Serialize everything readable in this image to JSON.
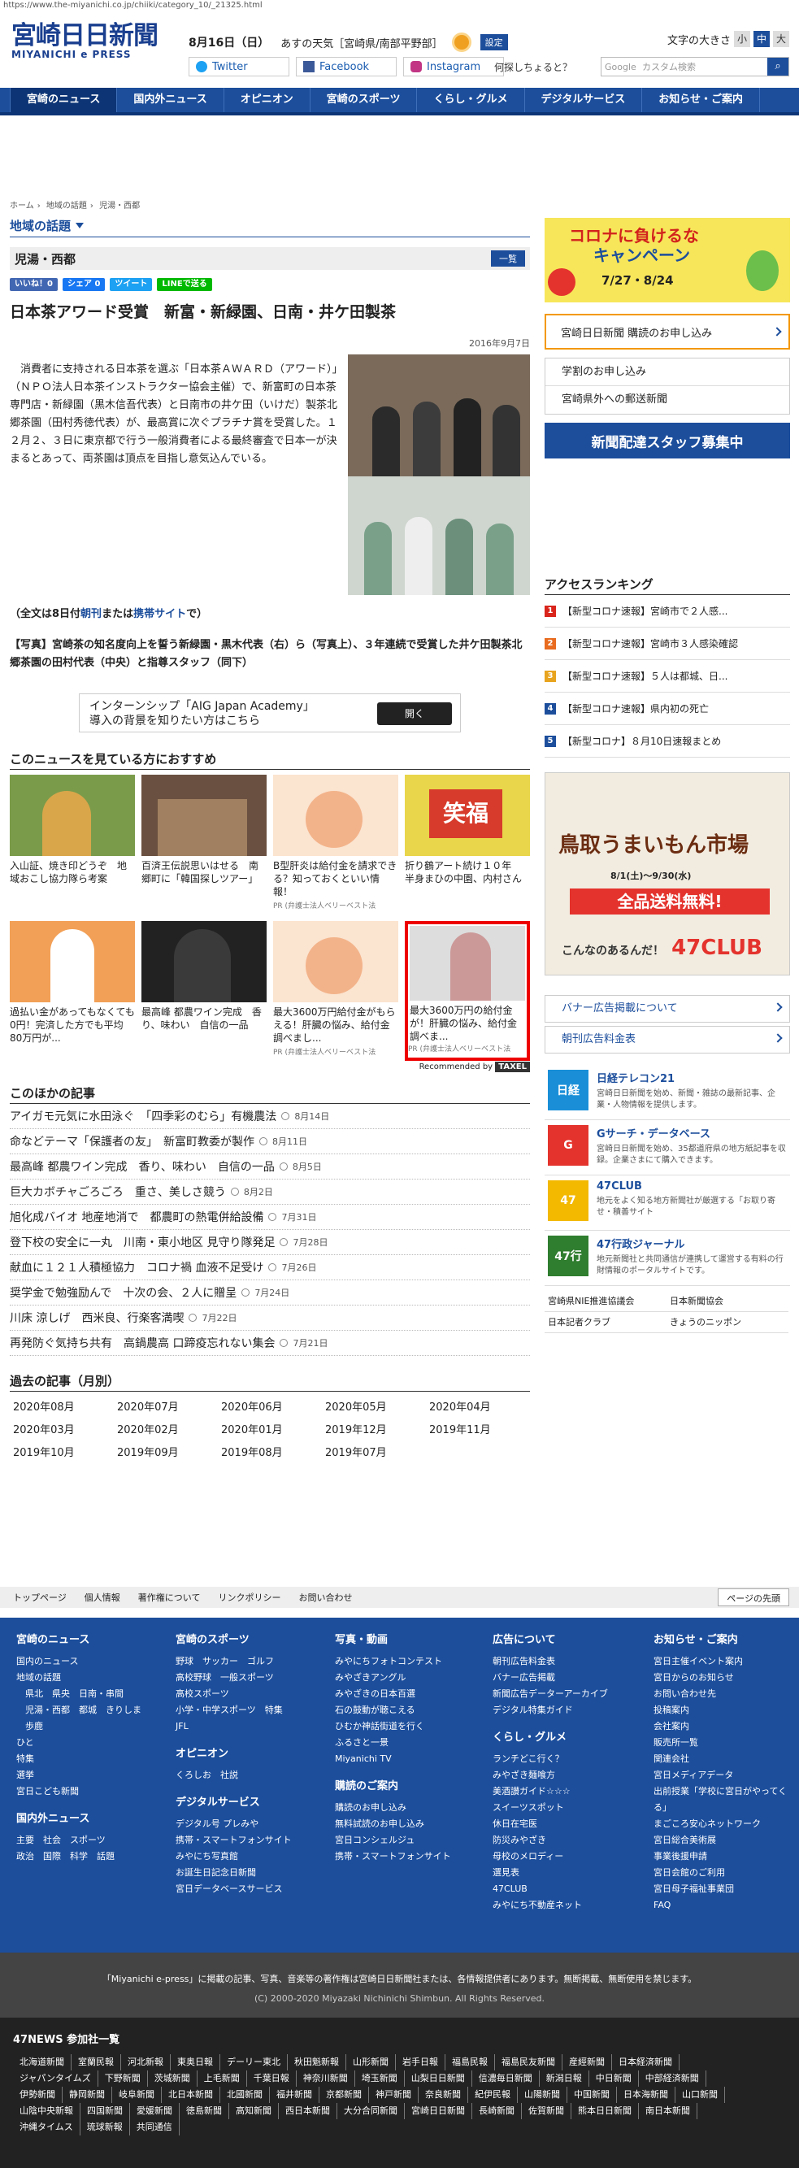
{
  "url": "https://www.the-miyanichi.co.jp/chiiki/category_10/_21325.html",
  "header": {
    "logo_main": "宮崎日日新聞",
    "logo_sub": "MIYANICHI e PRESS",
    "date": "8月16日（日）",
    "weather_label": "あすの天気［宮崎県/南部平野部］",
    "settings_label": "設定",
    "twitter": "Twitter",
    "facebook": "Facebook",
    "instagram": "Instagram",
    "font_size_label": "文字の大きさ",
    "font_small": "小",
    "font_medium": "中",
    "font_large": "大",
    "question_text": "何探しちょると？",
    "search_brand": "Google",
    "search_placeholder": "カスタム検索"
  },
  "nav": [
    "宮崎のニュース",
    "国内外ニュース",
    "オピニオン",
    "宮崎のスポーツ",
    "くらし・グルメ",
    "デジタルサービス",
    "お知らせ・ご案内"
  ],
  "breadcrumb": [
    "ホーム",
    "地域の話題",
    "児湯・西都"
  ],
  "section_title": "地域の話題",
  "subsection": "児湯・西都",
  "list_button": "一覧",
  "share": {
    "like": "いいね！0",
    "share": "シェア 0",
    "tweet": "ツイート",
    "line": "LINEで送る"
  },
  "article": {
    "title": "日本茶アワード受賞　新富・新緑園、日南・井ケ田製茶",
    "date": "2016年9月7日",
    "body": "消費者に支持される日本茶を選ぶ「日本茶ＡＷＡＲＤ（アワード）」（ＮＰＯ法人日本茶インストラクター協会主催）で、新富町の日本茶専門店・新緑園（黒木信吾代表）と日南市の井ケ田（いけだ）製茶北郷茶園（田村秀徳代表）が、最高賞に次ぐプラチナ賞を受賞した。１２月２、３日に東京都で行う一般消費者による最終審査で日本一が決まるとあって、両茶園は頂点を目指し意気込んでいる。",
    "full_prefix": "（全文は8日付",
    "full_link1": "朝刊",
    "full_mid": "または",
    "full_link2": "携帯サイト",
    "full_suffix": "で）",
    "caption": "【写真】宮崎茶の知名度向上を誓う新緑園・黒木代表（右）ら（写真上）、３年連続で受賞した井ケ田製茶北郷茶園の田村代表（中央）と指尊スタッフ（同下）"
  },
  "ad_banner": {
    "line1": "インターンシップ「AIG Japan Academy」",
    "line2": "導入の背景を知りたい方はこちら",
    "button": "開く"
  },
  "recommend": {
    "title": "このニュースを見ている方におすすめ",
    "items": [
      {
        "text": "入山証、焼き印どうぞ　地域おこし協力隊ら考案",
        "pr": ""
      },
      {
        "text": "百済王伝説思いはせる　南郷町に「韓国探しツアー」",
        "pr": ""
      },
      {
        "text": "B型肝炎は給付金を請求できる？知っておくといい情報！",
        "pr": "PR (弁護士法人ベリーベスト法"
      },
      {
        "text": "折り鶴アート続け１０年　半身まひの中園、内村さん",
        "pr": ""
      },
      {
        "text": "過払い金があってもなくても0円！完済した方でも平均80万円が...",
        "pr": ""
      },
      {
        "text": "最高峰 都農ワイン完成　香り、味わい　自信の一品",
        "pr": ""
      },
      {
        "text": "最大3600万円給付金がもらえる！肝臓の悩み、給付金調べまし...",
        "pr": "PR (弁護士法人ベリーベスト法"
      },
      {
        "text": "最大3600万円の給付金が！肝臓の悩み、給付金調べま...",
        "pr": "PR (弁護士法人ベリーベスト法"
      }
    ],
    "by_label": "Recommended by",
    "by_brand": "TAXEL"
  },
  "others": {
    "title": "このほかの記事",
    "items": [
      {
        "t": "アイガモ元気に水田泳ぐ　「四季彩のむら」有機農法",
        "d": "8月14日"
      },
      {
        "t": "命などテーマ「保護者の友」　新富町教委が製作",
        "d": "8月11日"
      },
      {
        "t": "最高峰 都農ワイン完成　香り、味わい　自信の一品",
        "d": "8月5日"
      },
      {
        "t": "巨大カボチャごろごろ　重さ、美しさ競う",
        "d": "8月2日"
      },
      {
        "t": "旭化成バイオ 地産地消で　都農町の熱電併給設備",
        "d": "7月31日"
      },
      {
        "t": "登下校の安全に一丸　川南・東小地区 見守り隊発足",
        "d": "7月28日"
      },
      {
        "t": "献血に１２１人積極協力　コロナ禍 血液不足受け",
        "d": "7月26日"
      },
      {
        "t": "奨学金で勉強励んで　十次の会、２人に贈呈",
        "d": "7月24日"
      },
      {
        "t": "川床 涼しげ　西米良、行楽客満喫",
        "d": "7月22日"
      },
      {
        "t": "再発防ぐ気持ち共有　高鍋農高 口蹄疫忘れない集会",
        "d": "7月21日"
      }
    ]
  },
  "past": {
    "title": "過去の記事（月別）",
    "months": [
      "2020年08月",
      "2020年07月",
      "2020年06月",
      "2020年05月",
      "2020年04月",
      "2020年03月",
      "2020年02月",
      "2020年01月",
      "2019年12月",
      "2019年11月",
      "2019年10月",
      "2019年09月",
      "2019年08月",
      "2019年07月"
    ]
  },
  "side": {
    "corona_title1": "コロナに負けるな",
    "corona_title2": "キャンペーン",
    "corona_dates": "7/27・8/24",
    "subscribe": "宮崎日日新聞 購読のお申し込み",
    "study": "学割のお申し込み",
    "outside": "宮崎県外への郵送新聞",
    "staff": "新聞配達スタッフ募集中",
    "ranking_title": "アクセスランキング",
    "ranking": [
      "【新型コロナ速報】宮崎市で２人感...",
      "【新型コロナ速報】宮崎市３人感染確認",
      "【新型コロナ速報】５人は都城、日...",
      "【新型コロナ速報】県内初の死亡",
      "【新型コロナ】８月10日速報まとめ"
    ],
    "tottori_big": "鳥取うまいもん市場",
    "tottori_period": "8/1(土)〜9/30(水)",
    "tottori_red": "全品送料無料!",
    "tottori_club": "47CLUB",
    "tottori_small": "こんなのあるんだ！",
    "banner_ad": "バナー広告掲載について",
    "ad_rates": "朝刊広告料金表",
    "services": [
      {
        "logo": "日経",
        "name": "日経テレコン21",
        "desc": "宮崎日日新聞を始め、新聞・雑誌の最新記事、企業・人物情報を提供します。"
      },
      {
        "logo": "G",
        "name": "Gサーチ・データベース",
        "desc": "宮崎日日新聞を始め、35都道府県の地方紙記事を収録。企業さまにて購入できます。"
      },
      {
        "logo": "47",
        "name": "47CLUB",
        "desc": "地元をよく知る地方新聞社が厳選する「お取り寄せ・積善サイト"
      },
      {
        "logo": "47行",
        "name": "47行政ジャーナル",
        "desc": "地元新聞社と共同通信が連携して運営する有料の行財情報のポータルサイトです。"
      }
    ],
    "mini_links": [
      "宮崎県NIE推進協議会",
      "日本新聞協会",
      "日本記者クラブ",
      "きょうのニッポン"
    ]
  },
  "footer_nav": [
    "トップページ",
    "個人情報",
    "著作権について",
    "リンクポリシー",
    "お問い合わせ"
  ],
  "page_top": "ページの先頭",
  "footer_cols": [
    {
      "h": "宮崎のニュース",
      "items": [
        "国内のニュース",
        "地域の話題",
        "　県北　県央　日南・串間",
        "　児湯・西都　都城　きりしま",
        "　歩鹿",
        "ひと",
        "特集",
        "選挙",
        "宮日こども新聞"
      ],
      "h2": "国内外ニュース",
      "items2": [
        "主要　社会　スポーツ",
        "政治　国際　科学　話題"
      ]
    },
    {
      "h": "宮崎のスポーツ",
      "items": [
        "野球　サッカー　ゴルフ",
        "高校野球　一般スポーツ",
        "高校スポーツ",
        "小学・中学スポーツ　特集",
        "JFL"
      ],
      "h2": "オピニオン",
      "items2": [
        "くろしお　社説"
      ],
      "h3": "デジタルサービス",
      "items3": [
        "デジタル号 プレみや",
        "携帯・スマートフォンサイト",
        "みやにち写真館",
        "お誕生日記念日新聞",
        "宮日データベースサービス"
      ]
    },
    {
      "h": "写真・動画",
      "items": [
        "みやにちフォトコンテスト",
        "みやざきアングル",
        "みやざきの日本百選",
        "石の鼓動が聴こえる",
        "ひむか神話街道を行く",
        "ふるさと一景",
        "Miyanichi TV"
      ],
      "h2": "購読のご案内",
      "items2": [
        "購読のお申し込み",
        "無料試読のお申し込み",
        "宮日コンシェルジュ",
        "携帯・スマートフォンサイト"
      ]
    },
    {
      "h": "広告について",
      "items": [
        "朝刊広告料金表",
        "バナー広告掲載",
        "新聞広告データーアーカイブ",
        "デジタル特集ガイド"
      ],
      "h2": "くらし・グルメ",
      "items2": [
        "ランチどこ行く？",
        "みやざき麺喰方",
        "美酒讃ガイド☆☆☆",
        "スイーツスポット",
        "休日在宅医",
        "防災みやざき",
        "母校のメロディー",
        "選見表",
        "47CLUB",
        "みやにち不動産ネット"
      ]
    },
    {
      "h": "お知らせ・ご案内",
      "items": [
        "宮日主催イベント案内",
        "宮日からのお知らせ",
        "お問い合わせ先",
        "投稿案内",
        "会社案内",
        "販売所一覧",
        "関連会社",
        "宮日メディアデータ",
        "出前授業「学校に宮日がやってくる」",
        "まごころ安心ネットワーク",
        "宮日総合美術展",
        "事業後援申請",
        "宮日会館のご利用",
        "宮日母子福祉事業団",
        "FAQ"
      ]
    }
  ],
  "copyright1": "「Miyanichi e-press」に掲載の記事、写真、音楽等の著作権は宮崎日日新聞社または、各情報提供者にあります。無断掲載、無断使用を禁じます。",
  "copyright2": "(C) 2000-2020 Miyazaki Nichinichi Shimbun. All Rights Reserved.",
  "news47": {
    "title": "47NEWS 参加社一覧",
    "items": [
      "北海道新聞",
      "室蘭民報",
      "河北新報",
      "東奥日報",
      "デーリー東北",
      "秋田魁新報",
      "山形新聞",
      "岩手日報",
      "福島民報",
      "福島民友新聞",
      "産經新聞",
      "日本経済新聞",
      "ジャパンタイムズ",
      "下野新聞",
      "茨城新聞",
      "上毛新聞",
      "千葉日報",
      "神奈川新聞",
      "埼玉新聞",
      "山梨日日新聞",
      "信濃毎日新聞",
      "新潟日報",
      "中日新聞",
      "中部経済新聞",
      "伊勢新聞",
      "静岡新聞",
      "岐阜新聞",
      "北日本新聞",
      "北國新聞",
      "福井新聞",
      "京都新聞",
      "神戸新聞",
      "奈良新聞",
      "紀伊民報",
      "山陽新聞",
      "中国新聞",
      "日本海新聞",
      "山口新聞",
      "山陰中央新報",
      "四国新聞",
      "愛媛新聞",
      "徳島新聞",
      "高知新聞",
      "西日本新聞",
      "大分合同新聞",
      "宮崎日日新聞",
      "長崎新聞",
      "佐賀新聞",
      "熊本日日新聞",
      "南日本新聞",
      "沖縄タイムス",
      "琉球新報",
      "共同通信"
    ]
  },
  "colors": {
    "brand": "#1c4e9c",
    "nav_active": "#0d3576",
    "highlight": "#e00000",
    "orange": "#f39800"
  }
}
